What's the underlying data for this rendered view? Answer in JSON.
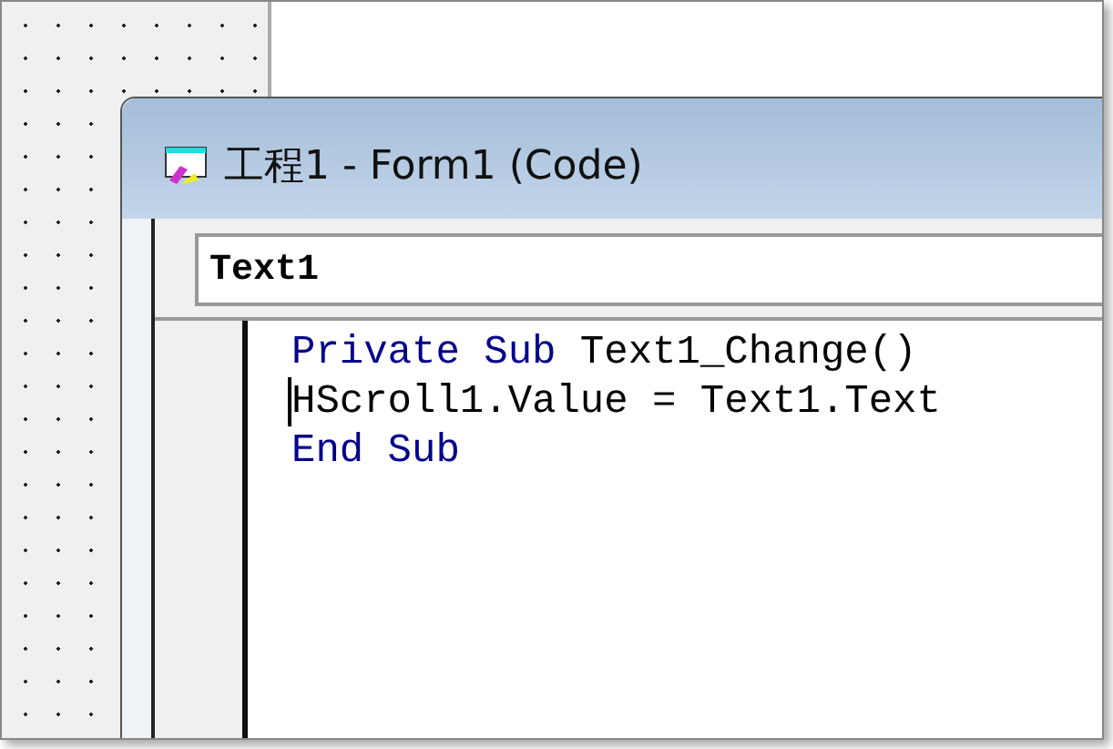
{
  "window": {
    "title": "工程1 - Form1 (Code)"
  },
  "object_combo": {
    "value": "Text1"
  },
  "code": {
    "lines": [
      {
        "has_cursor": false,
        "tokens": [
          {
            "kind": "keyword",
            "text": "Private Sub"
          },
          {
            "kind": "plain",
            "text": " Text1_Change()"
          }
        ]
      },
      {
        "has_cursor": true,
        "tokens": [
          {
            "kind": "plain",
            "text": "HScroll1.Value = Text1.Text"
          }
        ]
      },
      {
        "has_cursor": false,
        "tokens": [
          {
            "kind": "keyword",
            "text": "End Sub"
          }
        ]
      }
    ]
  }
}
